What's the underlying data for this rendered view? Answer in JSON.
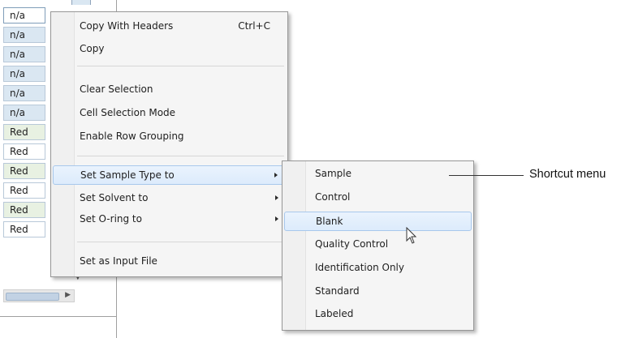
{
  "grid": {
    "cells": [
      {
        "value": "n/a",
        "style": "first"
      },
      {
        "value": "n/a",
        "style": "blue"
      },
      {
        "value": "n/a",
        "style": "blue"
      },
      {
        "value": "n/a",
        "style": "blue"
      },
      {
        "value": "n/a",
        "style": "blue"
      },
      {
        "value": "n/a",
        "style": "blue"
      },
      {
        "value": "Red",
        "style": "green"
      },
      {
        "value": "Red",
        "style": "white"
      },
      {
        "value": "Red",
        "style": "green"
      },
      {
        "value": "Red",
        "style": "white"
      },
      {
        "value": "Red",
        "style": "green"
      },
      {
        "value": "Red",
        "style": "white"
      }
    ]
  },
  "context_menu": {
    "copy_with_headers": {
      "label": "Copy With Headers",
      "shortcut": "Ctrl+C"
    },
    "copy": {
      "label": "Copy"
    },
    "clear_selection": {
      "label": "Clear Selection"
    },
    "cell_selection_mode": {
      "label": "Cell Selection Mode"
    },
    "enable_row_grouping": {
      "label": "Enable Row Grouping"
    },
    "set_sample_type": {
      "label": "Set Sample Type to"
    },
    "set_solvent": {
      "label": "Set Solvent to"
    },
    "set_oring": {
      "label": "Set O-ring to"
    },
    "set_input_file": {
      "label": "Set as Input File"
    }
  },
  "submenu": {
    "items": [
      {
        "label": "Sample"
      },
      {
        "label": "Control"
      },
      {
        "label": "Blank",
        "highlighted": true
      },
      {
        "label": "Quality Control"
      },
      {
        "label": "Identification Only"
      },
      {
        "label": "Standard"
      },
      {
        "label": "Labeled"
      }
    ]
  },
  "callout": {
    "text": "Shortcut menu"
  },
  "colors": {
    "menu_bg": "#f5f5f5",
    "highlight": "#dcebfc",
    "cell_blue": "#dae7f2",
    "cell_green": "#e8f1e2"
  },
  "icons": [
    "submenu-arrow-icon",
    "mouse-pointer-icon",
    "scroll-right-arrow-icon",
    "scroll-down-arrow-icon"
  ]
}
